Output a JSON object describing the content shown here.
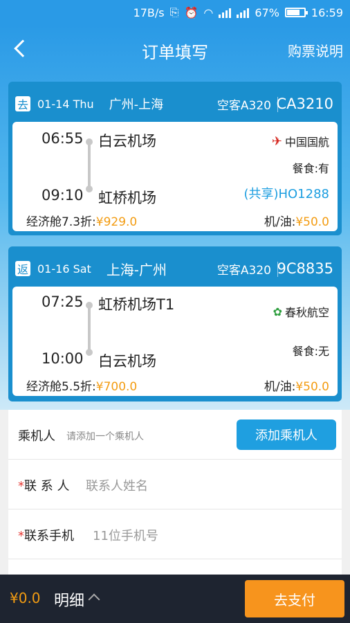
{
  "status_bar": {
    "speed": "17B/s",
    "net1": "4G",
    "net2": "2G",
    "battery": "67%",
    "time": "16:59"
  },
  "header": {
    "title": "订单填写",
    "help": "购票说明"
  },
  "outbound": {
    "badge": "去",
    "date": "01-14 Thu",
    "route": "广州-上海",
    "aircraft": "空客A320",
    "flight_no": "CA3210",
    "dep_time": "06:55",
    "dep_airport": "白云机场",
    "arr_time": "09:10",
    "arr_airport": "虹桥机场",
    "airline": "中国国航",
    "meal": "餐食:有",
    "share": "(共享)HO1288",
    "cabin_label": "经济舱7.3折:",
    "cabin_price": "¥929.0",
    "tax_label": "机/油:",
    "tax_price": "¥50.0"
  },
  "return": {
    "badge": "返",
    "date": "01-16 Sat",
    "route": "上海-广州",
    "aircraft": "空客A320",
    "flight_no": "9C8835",
    "dep_time": "07:25",
    "dep_airport": "虹桥机场T1",
    "arr_time": "10:00",
    "arr_airport": "白云机场",
    "airline": "春秋航空",
    "meal": "餐食:无",
    "cabin_label": "经济舱5.5折:",
    "cabin_price": "¥700.0",
    "tax_label": "机/油:",
    "tax_price": "¥50.0"
  },
  "form": {
    "passenger_label": "乘机人",
    "passenger_hint": "请添加一个乘机人",
    "add_passenger": "添加乘机人",
    "contact_label": "联 系 人",
    "contact_placeholder": "联系人姓名",
    "phone_label": "联系手机",
    "phone_placeholder": "11位手机号",
    "required_mark": "*"
  },
  "footer": {
    "total": "¥0.0",
    "detail": "明细",
    "pay": "去支付"
  },
  "colors": {
    "primary": "#1a8fce",
    "accent": "#f7941d",
    "price": "#f39c12"
  }
}
